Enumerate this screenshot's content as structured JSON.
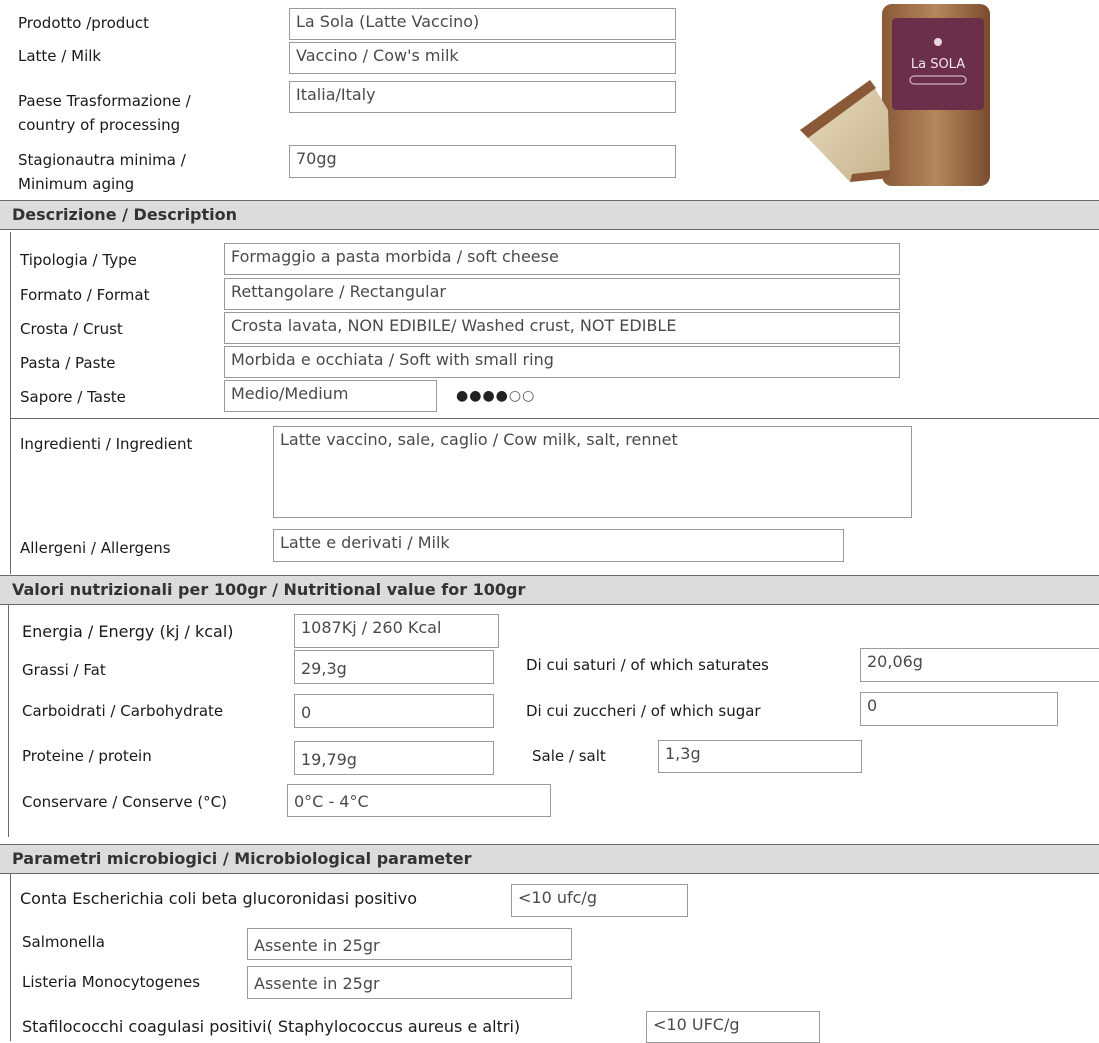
{
  "product": {
    "rows": [
      {
        "label": "Prodotto /product",
        "value": "La Sola (Latte Vaccino)"
      },
      {
        "label": "Latte / Milk",
        "value": "Vaccino / Cow's milk"
      },
      {
        "label": "Paese Trasformazione /",
        "label2": "country of processing",
        "value": "Italia/Italy"
      },
      {
        "label": "Stagionautra minima /",
        "label2": "Minimum aging",
        "value": "70gg"
      }
    ],
    "image": {
      "brand_text": "La SOLA",
      "alt_icon": "cheese-product-photo"
    }
  },
  "description": {
    "title": "Descrizione / Description",
    "rows": [
      {
        "label": "Tipologia / Type",
        "value": "Formaggio a pasta morbida / soft cheese"
      },
      {
        "label": "Formato / Format",
        "value": "Rettangolare / Rectangular"
      },
      {
        "label": "Crosta / Crust",
        "value": "Crosta lavata, NON EDIBILE/ Washed crust, NOT EDIBLE"
      },
      {
        "label": "Pasta / Paste",
        "value": "Morbida e occhiata / Soft with small ring"
      },
      {
        "label": "Sapore / Taste",
        "value": "Medio/Medium"
      }
    ],
    "taste_rating": {
      "filled": 4,
      "total": 6
    },
    "ingredients": {
      "label": "Ingredienti / Ingredient",
      "value": "Latte vaccino, sale, caglio / Cow milk, salt, rennet"
    },
    "allergens": {
      "label": "Allergeni / Allergens",
      "value": "Latte e derivati / Milk"
    }
  },
  "nutrition": {
    "title": "Valori nutrizionali per 100gr / Nutritional value for 100gr",
    "energy": {
      "label": "Energia / Energy (kj / kcal)",
      "value": "1087Kj / 260 Kcal"
    },
    "fat": {
      "label": "Grassi / Fat",
      "value": "29,3g"
    },
    "saturates": {
      "label": "Di cui saturi / of which saturates",
      "value": "20,06g"
    },
    "carbs": {
      "label": "Carboidrati / Carbohydrate",
      "value": "0"
    },
    "sugar": {
      "label": "Di cui zuccheri / of which sugar",
      "value": "0"
    },
    "protein": {
      "label": "Proteine / protein",
      "value": "19,79g"
    },
    "salt": {
      "label": "Sale / salt",
      "value": "1,3g"
    },
    "conserve": {
      "label": "Conservare / Conserve (°C)",
      "value": "0°C - 4°C"
    }
  },
  "micro": {
    "title": "Parametri microbiogici / Microbiological parameter",
    "ecoli": {
      "label": "Conta Escherichia coli beta glucoronidasi positivo",
      "value": "<10 ufc/g"
    },
    "salmonella": {
      "label": "Salmonella",
      "value": "Assente in 25gr"
    },
    "listeria": {
      "label": "Listeria Monocytogenes",
      "value": "Assente in 25gr"
    },
    "staph": {
      "label": "Stafilococchi coagulasi positivi( Staphylococcus aureus e altri)",
      "value": "<10 UFC/g"
    }
  }
}
